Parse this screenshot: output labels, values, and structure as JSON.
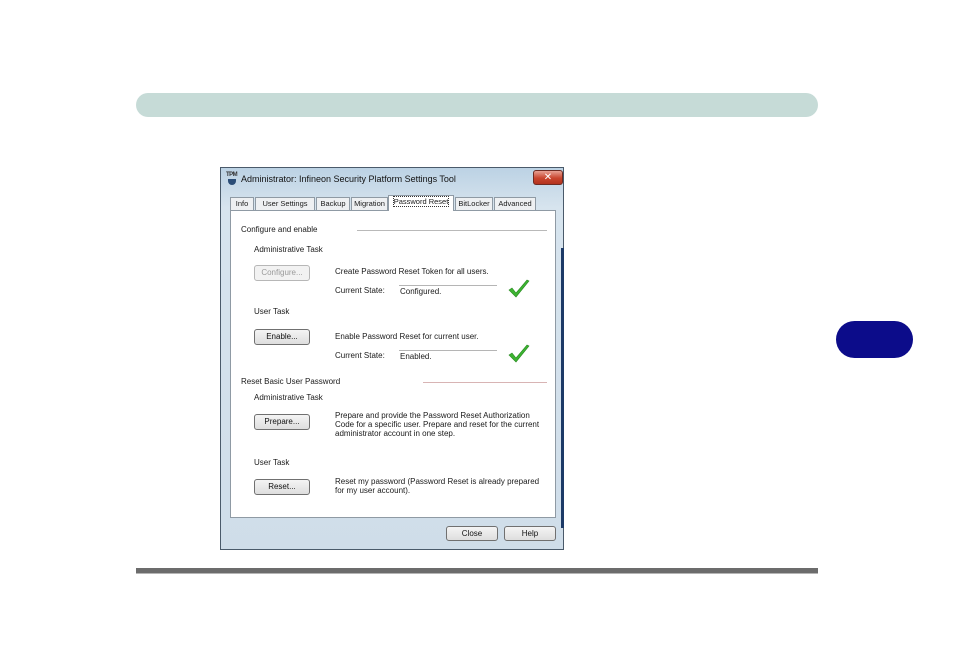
{
  "window": {
    "title": "Administrator: Infineon Security Platform Settings Tool",
    "icon_text": "TPM",
    "close_glyph": "✕"
  },
  "tabs": [
    {
      "label": "Info",
      "active": false
    },
    {
      "label": "User Settings",
      "active": false
    },
    {
      "label": "Backup",
      "active": false
    },
    {
      "label": "Migration",
      "active": false
    },
    {
      "label": "Password Reset",
      "active": true
    },
    {
      "label": "BitLocker",
      "active": false
    },
    {
      "label": "Advanced",
      "active": false
    }
  ],
  "configure_section": {
    "heading": "Configure and enable",
    "admin_task": {
      "label": "Administrative Task",
      "button": "Configure...",
      "description": "Create Password Reset Token for all users.",
      "state_label": "Current State:",
      "state_value": "Configured.",
      "state_icon": "green-check-icon"
    },
    "user_task": {
      "label": "User Task",
      "button": "Enable...",
      "description": "Enable Password Reset for current user.",
      "state_label": "Current State:",
      "state_value": "Enabled.",
      "state_icon": "green-check-icon"
    }
  },
  "reset_section": {
    "heading": "Reset Basic User Password",
    "admin_task": {
      "label": "Administrative Task",
      "button": "Prepare...",
      "description": "Prepare and provide the Password Reset Authorization Code for a specific user. Prepare and reset for the current administrator account in one step."
    },
    "user_task": {
      "label": "User Task",
      "button": "Reset...",
      "description": "Reset my password (Password Reset is already prepared for my user account)."
    }
  },
  "footer": {
    "close_button": "Close",
    "help_button": "Help"
  },
  "colors": {
    "header_bar": "#c6dbd7",
    "chapter_badge": "#0c0c8a",
    "check_green": "#3cb431"
  }
}
